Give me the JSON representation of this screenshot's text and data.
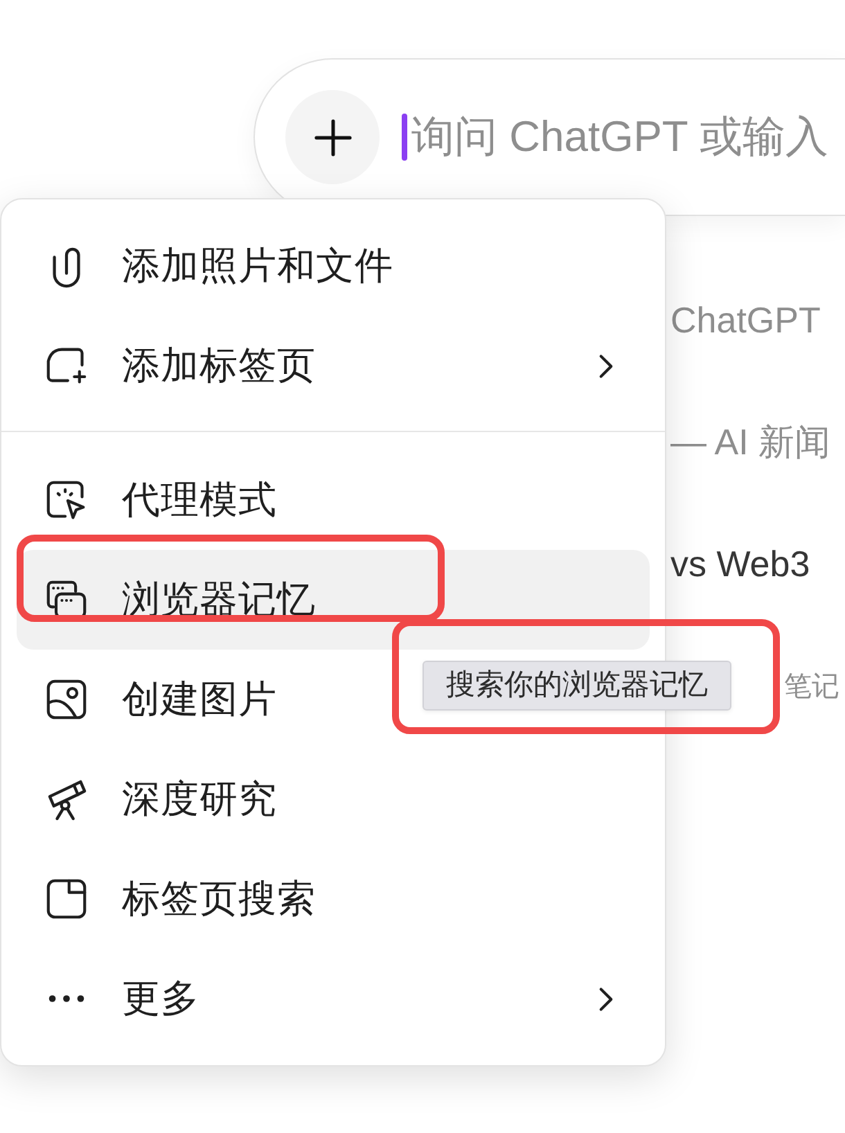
{
  "composer": {
    "placeholder": "询问 ChatGPT 或输入",
    "focused": true
  },
  "background_lines": [
    {
      "text": "ChatGPT",
      "muted": true
    },
    {
      "text": "— AI 新闻",
      "muted": true
    },
    {
      "text": "vs Web3",
      "muted": false
    },
    {
      "text": "笔记",
      "muted": true
    }
  ],
  "menu": {
    "sections": [
      {
        "items": [
          {
            "label": "添加照片和文件",
            "submenu": false,
            "selected": false,
            "annotated": false
          },
          {
            "label": "添加标签页",
            "submenu": true,
            "selected": false,
            "annotated": false
          }
        ]
      },
      {
        "items": [
          {
            "label": "代理模式",
            "submenu": false,
            "selected": false,
            "annotated": false
          },
          {
            "label": "浏览器记忆",
            "submenu": false,
            "selected": true,
            "annotated": true
          },
          {
            "label": "创建图片",
            "submenu": false,
            "selected": false,
            "annotated": false
          },
          {
            "label": "深度研究",
            "submenu": false,
            "selected": false,
            "annotated": false
          },
          {
            "label": "标签页搜索",
            "submenu": false,
            "selected": false,
            "annotated": false
          },
          {
            "label": "更多",
            "submenu": true,
            "selected": false,
            "annotated": false
          }
        ]
      }
    ]
  },
  "tooltip": {
    "text": "搜索你的浏览器记忆",
    "annotated": true
  }
}
